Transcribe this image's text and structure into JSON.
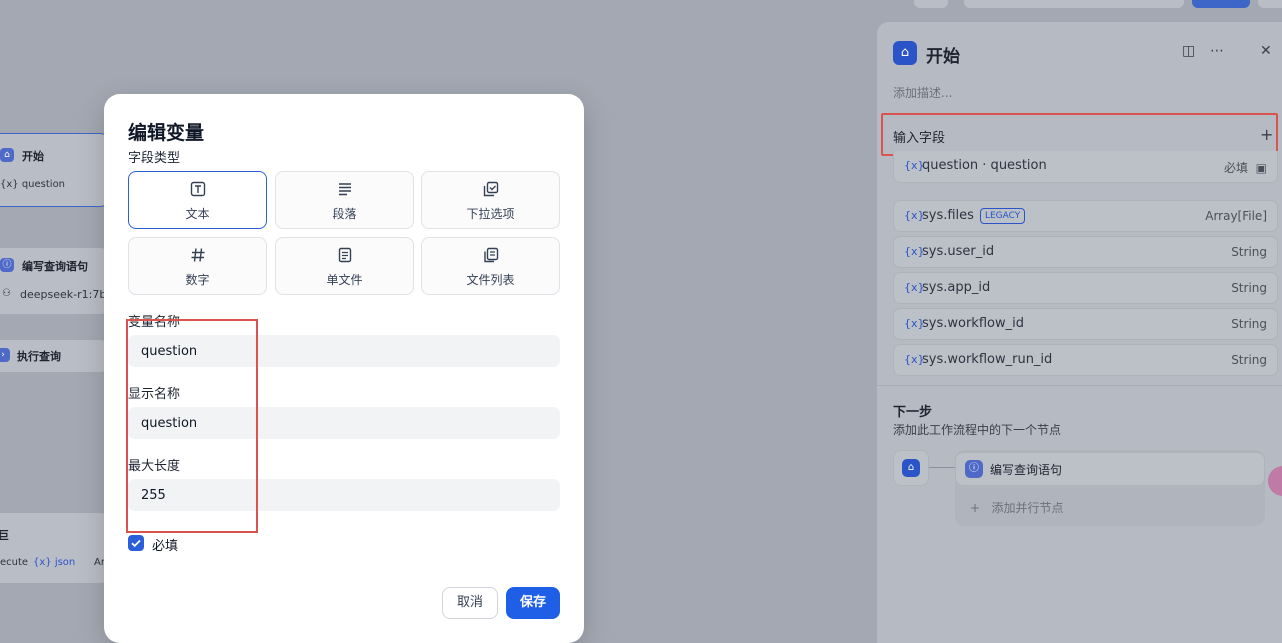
{
  "canvas": {
    "nodes": {
      "start_title": "开始",
      "start_var": "{x} question",
      "write_query_title": "编写查询语句",
      "model_name": "deepseek-r1:7b",
      "execute_title": "执行查询",
      "bottom_left_title": "巨",
      "bottom_left_sub": "ecute",
      "bottom_left_var": "{x} json",
      "bottom_left_type": "Ar"
    }
  },
  "panel": {
    "title": "开始",
    "description_placeholder": "添加描述...",
    "input_fields_label": "输入字段",
    "add_symbol": "+",
    "required_label": "必填",
    "variables": [
      {
        "name": "question · question",
        "type": ""
      },
      {
        "name": "sys.files",
        "badge": "LEGACY",
        "type": "Array[File]"
      },
      {
        "name": "sys.user_id",
        "type": "String"
      },
      {
        "name": "sys.app_id",
        "type": "String"
      },
      {
        "name": "sys.workflow_id",
        "type": "String"
      },
      {
        "name": "sys.workflow_run_id",
        "type": "String"
      }
    ],
    "var_prefix": "{x}",
    "next_step_title": "下一步",
    "next_step_desc": "添加此工作流程中的下一个节点",
    "next_node_label": "编写查询语句",
    "add_parallel_label": "添加并行节点"
  },
  "modal": {
    "title": "编辑变量",
    "field_type_label": "字段类型",
    "field_types": [
      {
        "label": "文本",
        "icon": "text-type-icon",
        "selected": true
      },
      {
        "label": "段落",
        "icon": "paragraph-icon",
        "selected": false
      },
      {
        "label": "下拉选项",
        "icon": "select-icon",
        "selected": false
      },
      {
        "label": "数字",
        "icon": "number-icon",
        "selected": false
      },
      {
        "label": "单文件",
        "icon": "file-icon",
        "selected": false
      },
      {
        "label": "文件列表",
        "icon": "file-list-icon",
        "selected": false
      }
    ],
    "variable_name_label": "变量名称",
    "variable_name_value": "question",
    "display_name_label": "显示名称",
    "display_name_value": "question",
    "max_length_label": "最大长度",
    "max_length_value": "255",
    "required_label": "必填",
    "required_checked": true,
    "cancel_label": "取消",
    "save_label": "保存"
  },
  "colors": {
    "accent": "#1f5ee6",
    "highlight_border": "#d9534f"
  }
}
